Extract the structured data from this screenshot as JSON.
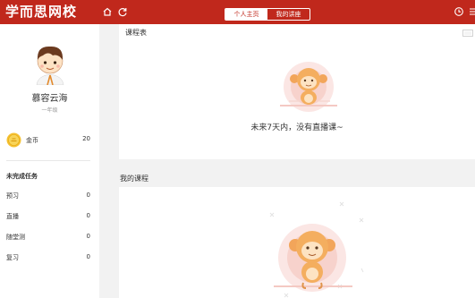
{
  "app": {
    "title": "学而思网校"
  },
  "header": {
    "tabs": [
      {
        "label": "个人主页",
        "active": true
      },
      {
        "label": "我的讲座",
        "active": false
      }
    ],
    "icons": [
      "home-icon",
      "refresh-icon",
      "history-icon",
      "menu-icon"
    ]
  },
  "profile": {
    "name": "慕容云海",
    "grade": "一年级",
    "coin_label": "金币",
    "coin_value": "20"
  },
  "tasks": {
    "title": "未完成任务",
    "items": [
      {
        "label": "预习",
        "count": "0"
      },
      {
        "label": "直播",
        "count": "0"
      },
      {
        "label": "随堂测",
        "count": "0"
      },
      {
        "label": "复习",
        "count": "0"
      }
    ]
  },
  "schedule": {
    "title": "课程表",
    "empty_text": "未来7天内，没有直播课~"
  },
  "my_courses": {
    "title": "我的课程"
  },
  "colors": {
    "brand": "#c0281c",
    "background": "#f2f2f2"
  }
}
